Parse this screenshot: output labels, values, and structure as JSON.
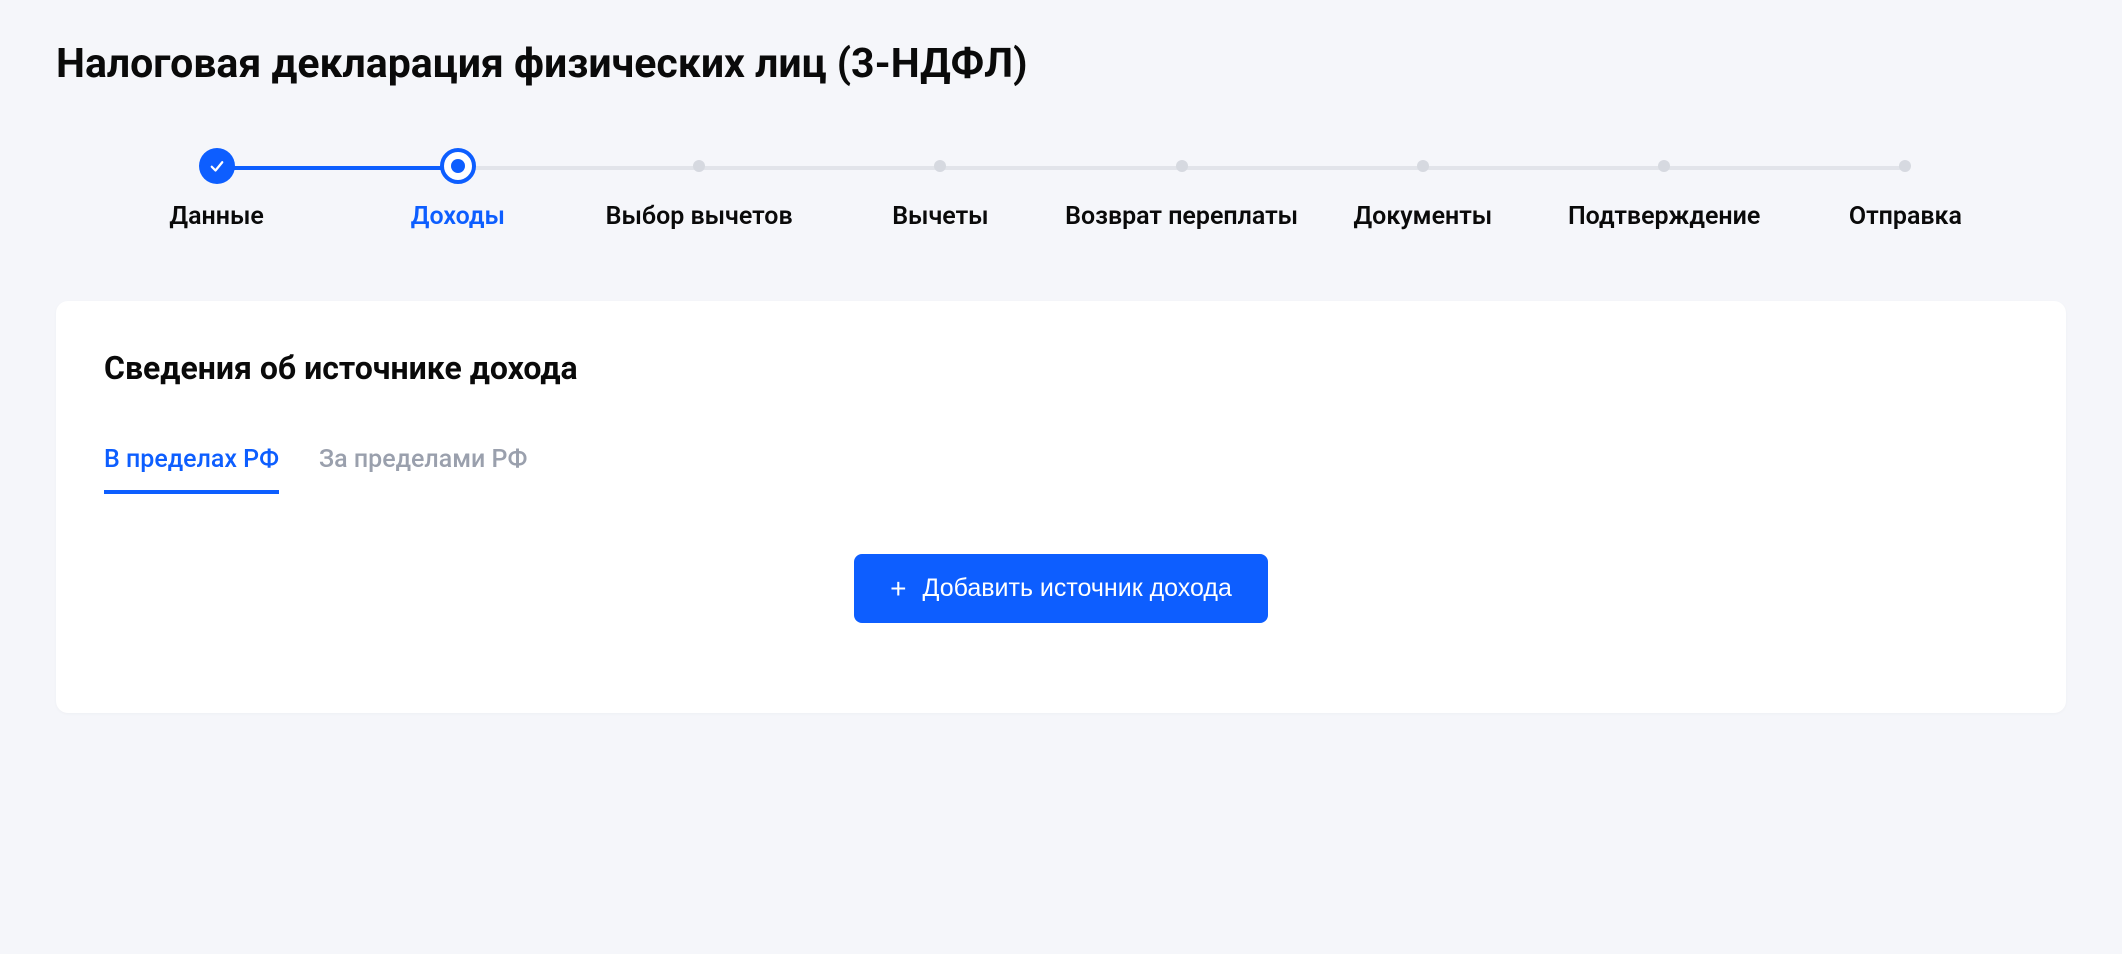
{
  "page_title": "Налоговая декларация физических лиц (3-НДФЛ)",
  "stepper": {
    "steps": [
      {
        "label": "Данные",
        "state": "done"
      },
      {
        "label": "Доходы",
        "state": "current"
      },
      {
        "label": "Выбор вычетов",
        "state": "upcoming"
      },
      {
        "label": "Вычеты",
        "state": "upcoming"
      },
      {
        "label": "Возврат переплаты",
        "state": "upcoming"
      },
      {
        "label": "Документы",
        "state": "upcoming"
      },
      {
        "label": "Подтверждение",
        "state": "upcoming"
      },
      {
        "label": "Отправка",
        "state": "upcoming"
      }
    ]
  },
  "card": {
    "title": "Сведения об источнике дохода",
    "tabs": [
      {
        "label": "В пределах РФ",
        "active": true
      },
      {
        "label": "За пределами РФ",
        "active": false
      }
    ],
    "add_button_label": "Добавить источник дохода"
  }
}
